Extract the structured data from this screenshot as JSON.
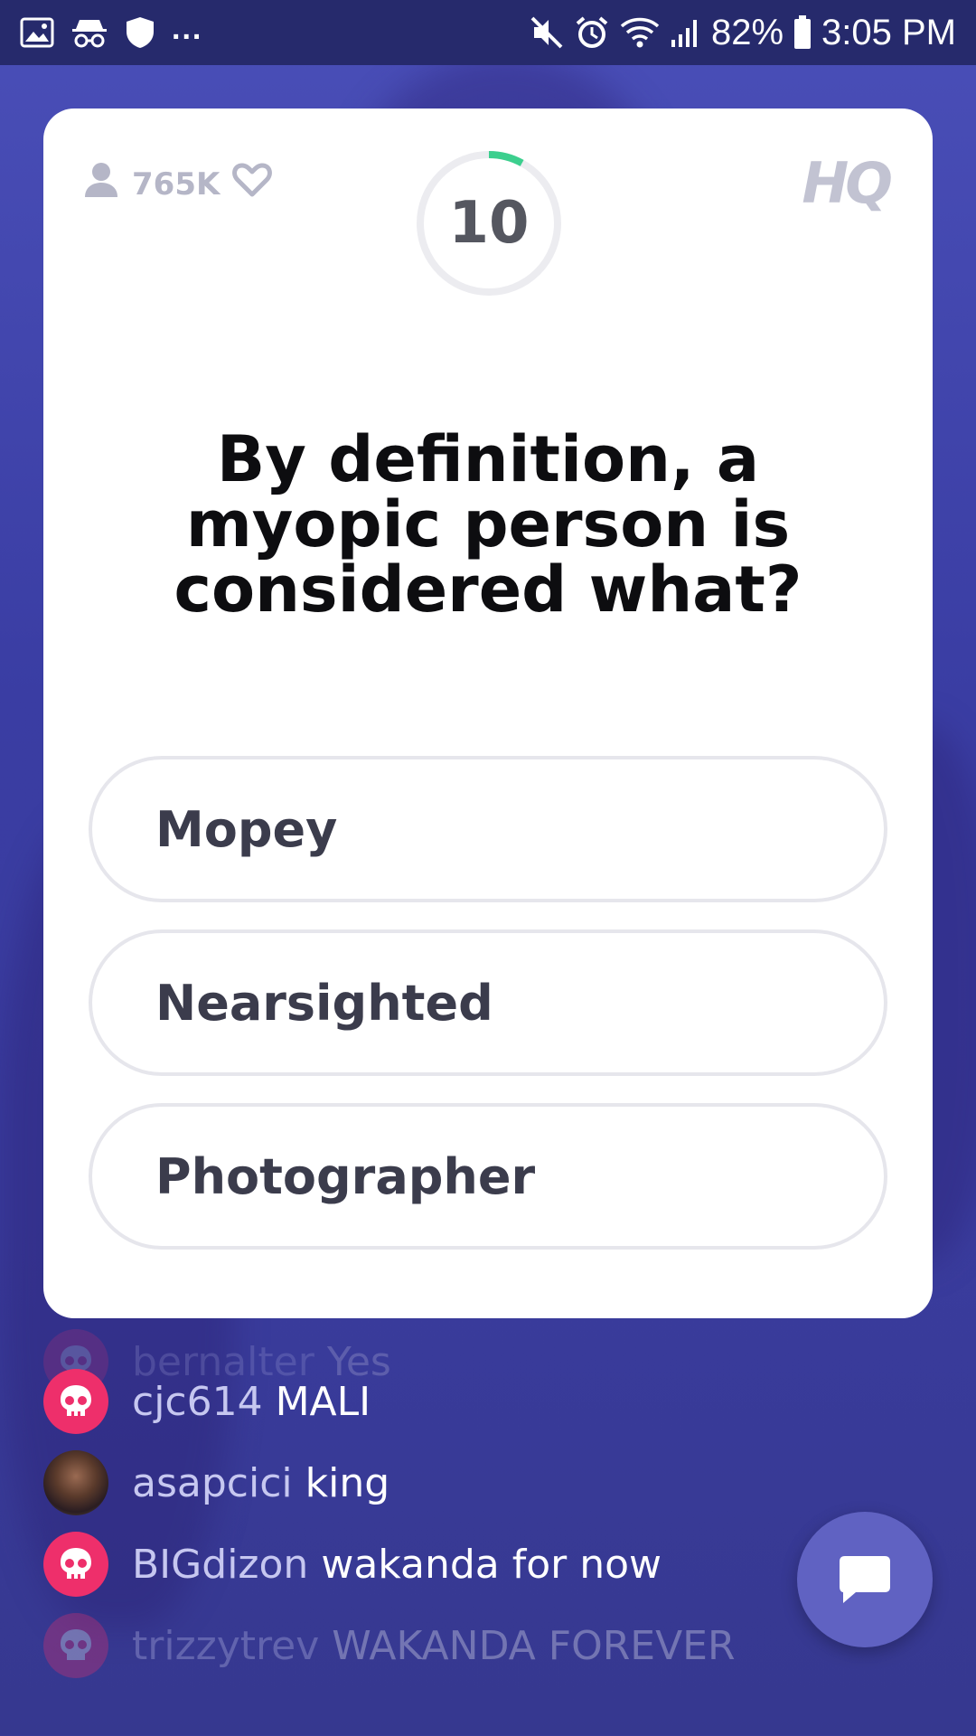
{
  "status_bar": {
    "left_icons": [
      "image-icon",
      "incognito-icon",
      "shield-icon"
    ],
    "more_indicator": "...",
    "right_icons": [
      "mute-icon",
      "alarm-icon",
      "wifi-icon",
      "signal-icon",
      "battery-icon"
    ],
    "battery": "82%",
    "time": "3:05 PM"
  },
  "card": {
    "viewer_count": "765K",
    "logo": "HQ",
    "timer": "10",
    "timer_progress": 0.08,
    "question": "By definition, a myopic person is considered what?",
    "answers": [
      {
        "label": "Mopey"
      },
      {
        "label": "Nearsighted"
      },
      {
        "label": "Photographer"
      }
    ]
  },
  "chat": {
    "messages": [
      {
        "user": "bernalter",
        "text": "Yes",
        "avatar": "pink"
      },
      {
        "user": "cjc614",
        "text": "MALI",
        "avatar": "pink"
      },
      {
        "user": "asapcici",
        "text": "king",
        "avatar": "photo"
      },
      {
        "user": "BIGdizon",
        "text": "wakanda for now",
        "avatar": "pink"
      },
      {
        "user": "trizzytrev",
        "text": "WAKANDA FOREVER",
        "avatar": "pink"
      }
    ]
  },
  "colors": {
    "background": "#3a3da3",
    "accent_green": "#3ccf8e",
    "avatar_pink": "#ee2f6b",
    "chat_button": "#6062c2"
  }
}
